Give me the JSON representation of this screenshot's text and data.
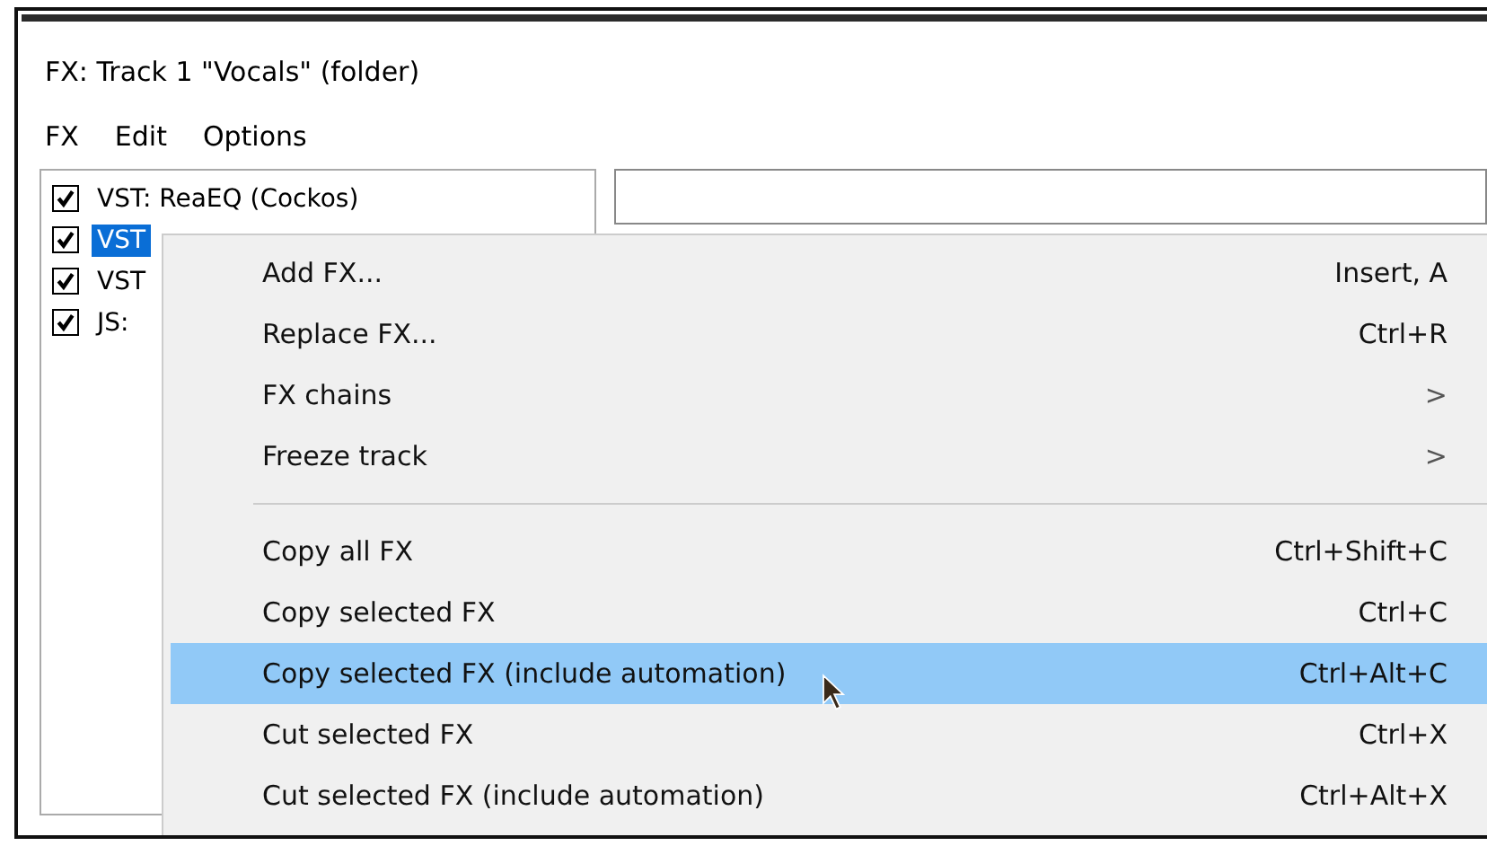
{
  "window": {
    "title": "FX: Track 1 \"Vocals\" (folder)"
  },
  "menu_bar": [
    {
      "label": "FX"
    },
    {
      "label": "Edit"
    },
    {
      "label": "Options"
    }
  ],
  "fx_list": [
    {
      "name": "VST: ReaEQ (Cockos)",
      "checked": true,
      "selected": false
    },
    {
      "name": "VST",
      "checked": true,
      "selected": true
    },
    {
      "name": "VST",
      "checked": true,
      "selected": false
    },
    {
      "name": "JS:",
      "checked": true,
      "selected": false
    }
  ],
  "context_menu": {
    "items": [
      {
        "kind": "item",
        "label": "Add FX...",
        "shortcut": "Insert, A",
        "selected": false
      },
      {
        "kind": "item",
        "label": "Replace FX...",
        "shortcut": "Ctrl+R",
        "selected": false
      },
      {
        "kind": "submenu",
        "label": "FX chains",
        "shortcut": ">",
        "selected": false
      },
      {
        "kind": "submenu",
        "label": "Freeze track",
        "shortcut": ">",
        "selected": false
      },
      {
        "kind": "separator"
      },
      {
        "kind": "item",
        "label": "Copy all FX",
        "shortcut": "Ctrl+Shift+C",
        "selected": false
      },
      {
        "kind": "item",
        "label": "Copy selected FX",
        "shortcut": "Ctrl+C",
        "selected": false
      },
      {
        "kind": "item",
        "label": "Copy selected FX (include automation)",
        "shortcut": "Ctrl+Alt+C",
        "selected": true
      },
      {
        "kind": "item",
        "label": "Cut selected FX",
        "shortcut": "Ctrl+X",
        "selected": false
      },
      {
        "kind": "item",
        "label": "Cut selected FX (include automation)",
        "shortcut": "Ctrl+Alt+X",
        "selected": false
      }
    ]
  }
}
